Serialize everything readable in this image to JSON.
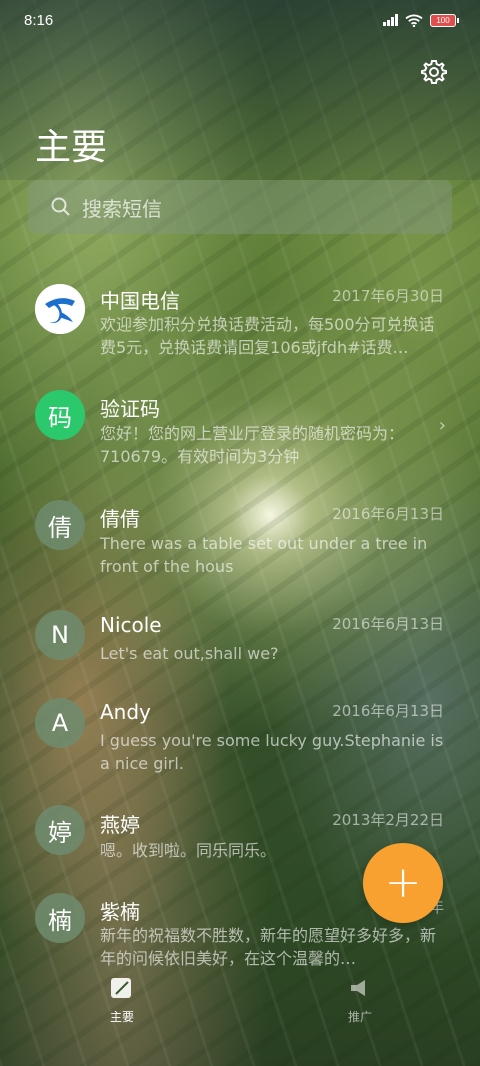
{
  "status_bar": {
    "time": "8:16",
    "battery": "100"
  },
  "header": {
    "title": "主要"
  },
  "search": {
    "placeholder": "搜索短信"
  },
  "conversations": [
    {
      "avatar": "",
      "avatar_color": "#ffffff",
      "name": "中国电信",
      "date": "2017年6月30日",
      "preview": "欢迎参加积分兑换话费活动，每500分可兑换话费5元，兑换话费请回复106或jfdh#话费…"
    },
    {
      "avatar": "码",
      "avatar_color": "#2cc86c",
      "name": "验证码",
      "date": "",
      "preview": "您好！您的网上营业厅登录的随机密码为：710679。有效时间为3分钟"
    },
    {
      "avatar": "倩",
      "avatar_color": "#7f9a78",
      "name": "倩倩",
      "date": "2016年6月13日",
      "preview": "There was a table set out under a tree in front of the hous"
    },
    {
      "avatar": "N",
      "avatar_color": "#7f9a78",
      "name": "Nicole",
      "date": "2016年6月13日",
      "preview": "Let's eat out,shall we?"
    },
    {
      "avatar": "A",
      "avatar_color": "#7f9a78",
      "name": "Andy",
      "date": "2016年6月13日",
      "preview": "I guess you're some lucky guy.Stephanie is a nice girl."
    },
    {
      "avatar": "婷",
      "avatar_color": "#7f9a78",
      "name": "燕婷",
      "date": "2013年2月22日",
      "preview": "嗯。收到啦。同乐同乐。"
    },
    {
      "avatar": "楠",
      "avatar_color": "#7f9a78",
      "name": "紫楠",
      "date": "2013年",
      "preview": "新年的祝福数不胜数，新年的愿望好多好多，新年的问候依旧美好，在这个温馨的…"
    }
  ],
  "fab": {
    "label": "+"
  },
  "bottom_nav": [
    {
      "label": "主要"
    },
    {
      "label": "推广"
    }
  ]
}
